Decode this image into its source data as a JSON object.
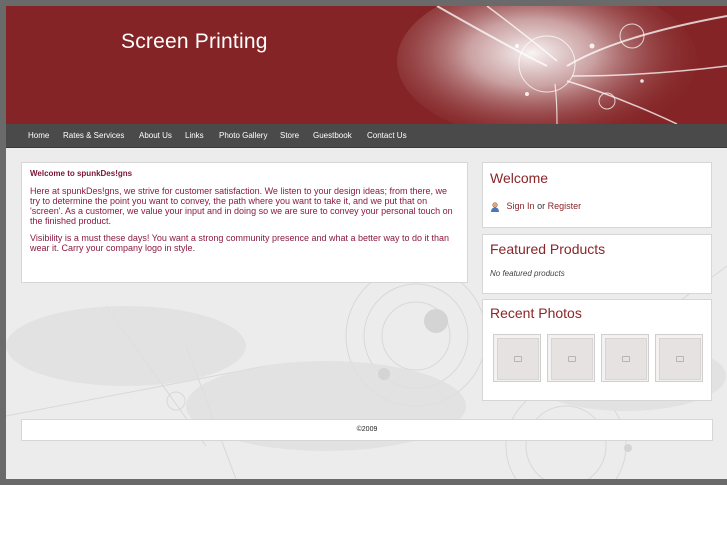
{
  "header": {
    "site_title": "Screen Printing"
  },
  "nav": {
    "items": [
      {
        "label": "Home"
      },
      {
        "label": "Rates & Services"
      },
      {
        "label": "About Us"
      },
      {
        "label": "Links"
      },
      {
        "label": "Photo Gallery"
      },
      {
        "label": "Store"
      },
      {
        "label": "Guestbook"
      },
      {
        "label": "Contact Us"
      }
    ]
  },
  "main": {
    "heading": "Welcome to spunkDes!gns",
    "paragraph1": "Here at spunkDes!gns, we strive for customer satisfaction.  We listen to your design ideas; from there, we try to determine the point you want to convey, the path where you want to take it, and we put that on 'screen'.  As a customer, we value your input and in doing so we are sure to convey your personal touch on the finished product.",
    "paragraph2": "Visibility is a must these days!  You want a strong community presence and what a better way to do it than wear it.  Carry your company logo in style."
  },
  "sidebar": {
    "welcome": {
      "title": "Welcome",
      "sign_in": "Sign In",
      "or": "or",
      "register": "Register",
      "icon": "user-icon"
    },
    "featured": {
      "title": "Featured Products",
      "empty_text": "No featured products"
    },
    "photos": {
      "title": "Recent Photos",
      "count": 4
    }
  },
  "footer": {
    "copyright": "©2009"
  },
  "colors": {
    "brand_red": "#842426",
    "nav_bg": "#4a4a4a",
    "text_maroon": "#8a1a40"
  }
}
